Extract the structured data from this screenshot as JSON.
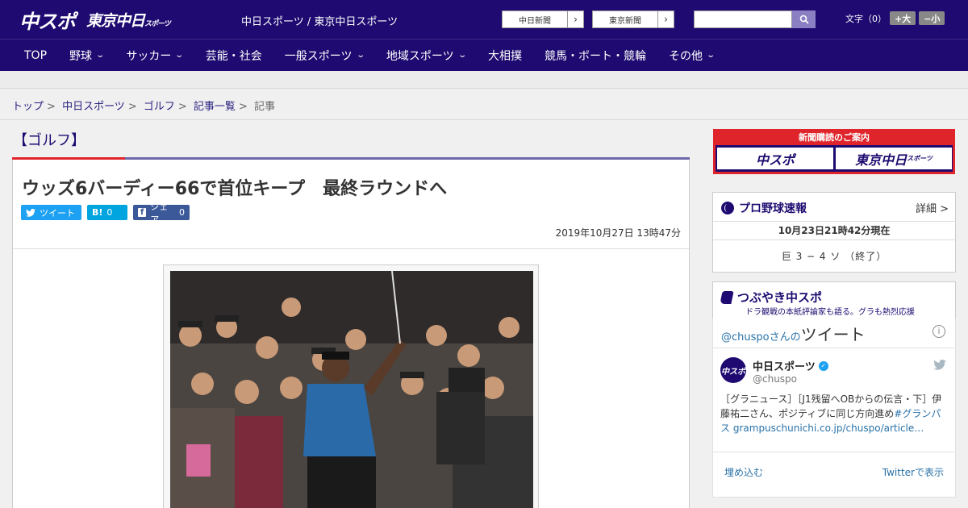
{
  "header": {
    "logo_main": "中スポ",
    "logo_sub": "東京中日",
    "logo_sub_small": "スポーツ",
    "site_names": "中日スポーツ / 東京中日スポーツ",
    "ext_link_1": "中日新聞",
    "ext_link_2": "東京新聞",
    "search_placeholder": "",
    "font_label": "文字（0）",
    "font_larger": "+大",
    "font_smaller": "−小"
  },
  "nav": {
    "items": [
      {
        "label": "TOP",
        "has_menu": false
      },
      {
        "label": "野球",
        "has_menu": true
      },
      {
        "label": "サッカー",
        "has_menu": true
      },
      {
        "label": "芸能・社会",
        "has_menu": false
      },
      {
        "label": "一般スポーツ",
        "has_menu": true
      },
      {
        "label": "地域スポーツ",
        "has_menu": true
      },
      {
        "label": "大相撲",
        "has_menu": false
      },
      {
        "label": "競馬・ボート・競輪",
        "has_menu": false
      },
      {
        "label": "その他",
        "has_menu": true
      }
    ]
  },
  "breadcrumb": [
    "トップ",
    "中日スポーツ",
    "ゴルフ",
    "記事一覧",
    "記事"
  ],
  "article": {
    "category": "【ゴルフ】",
    "headline": "ウッズ6バーディー66で首位キープ　最終ラウンドへ",
    "share_tweet": "ツイート",
    "share_hatena": "B!",
    "share_hatena_count": "0",
    "share_facebook": "シェア",
    "share_facebook_count": "0",
    "date": "2019年10月27日 13時47分"
  },
  "sidebar": {
    "ad_title": "新聞購読のご案内",
    "ad_left": "中スポ",
    "ad_right": "東京中日",
    "ad_right_small": "スポーツ",
    "baseball_title": "プロ野球速報",
    "baseball_detail": "詳細 >",
    "baseball_time": "10月23日21時42分現在",
    "baseball_score": "巨 3 − 4 ソ （終了）",
    "tsubuyaki_title": "つぶやき中スポ",
    "tsubuyaki_sub": "ドラ観戦の本紙評論家も語る。グラも熱烈応援",
    "twitter_handle": "@chuspoさんの",
    "twitter_label": "ツイート",
    "tweet_name": "中日スポーツ",
    "tweet_at": "@chuspo",
    "tweet_text_1": "［グラニュース］［J1残留へOBからの伝言・下］伊藤祐二さん、ポジティブに同じ方向進め",
    "tweet_text_tag": "#グランパス",
    "tweet_text_url": "grampuschunichi.co.jp/chuspo/article…",
    "embed_label": "埋め込む",
    "view_label": "Twitterで表示"
  },
  "colors": {
    "brand": "#1e0a70",
    "accent_red": "#e0242c",
    "twitter": "#1da1f2",
    "facebook": "#3b5998",
    "hatena": "#00a4de"
  }
}
